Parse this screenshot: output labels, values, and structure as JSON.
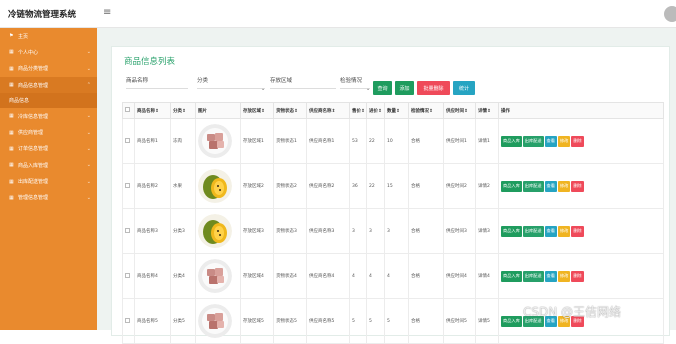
{
  "app": {
    "title": "冷链物流管理系统",
    "menu_icon": "menu-icon"
  },
  "sidebar": {
    "items": [
      {
        "label": "主页",
        "icon": "flag-icon",
        "chevron": false
      },
      {
        "label": "个人中心",
        "icon": "grid-icon",
        "chevron": true
      },
      {
        "label": "商品分类管理",
        "icon": "grid-icon",
        "chevron": true
      },
      {
        "label": "商品信息管理",
        "icon": "grid-icon",
        "chevron": true,
        "open": true
      },
      {
        "label": "冷库信息管理",
        "icon": "grid-icon",
        "chevron": true
      },
      {
        "label": "供应商管理",
        "icon": "grid-icon",
        "chevron": true
      },
      {
        "label": "订单信息管理",
        "icon": "grid-icon",
        "chevron": true
      },
      {
        "label": "商品入库管理",
        "icon": "grid-icon",
        "chevron": true
      },
      {
        "label": "出库配送管理",
        "icon": "grid-icon",
        "chevron": true
      },
      {
        "label": "管理信息管理",
        "icon": "grid-icon",
        "chevron": true
      }
    ],
    "sub_item": "商品信息"
  },
  "card": {
    "title": "商品信息列表"
  },
  "filters": {
    "name_label": "商品名称",
    "category_label": "分类",
    "storage_label": "存放区域",
    "inspection_label": "检验情况"
  },
  "buttons": {
    "query": "查询",
    "add": "添加",
    "batch_delete": "批量删除",
    "stats": "统计"
  },
  "table": {
    "headers": [
      "商品名称⇕",
      "分类⇕",
      "图片",
      "存放区域⇕",
      "货物状态⇕",
      "供应商名称⇕",
      "售价⇕",
      "进价⇕",
      "数量⇕",
      "检验情况⇕",
      "供应时间⇕",
      "详情⇕",
      "操作"
    ],
    "rows": [
      {
        "name": "商品名称1",
        "category": "冻肉",
        "image": "meat",
        "area": "存放区域1",
        "status": "货物状态1",
        "supplier": "供应商名称1",
        "price": "53",
        "cost": "22",
        "qty": "10",
        "check": "合格",
        "time": "供应时间1",
        "detail": "详情1"
      },
      {
        "name": "商品名称2",
        "category": "水果",
        "image": "fruit",
        "area": "存放区域2",
        "status": "货物状态2",
        "supplier": "供应商名称2",
        "price": "36",
        "cost": "22",
        "qty": "15",
        "check": "合格",
        "time": "供应时间2",
        "detail": "详情2"
      },
      {
        "name": "商品名称3",
        "category": "分类3",
        "image": "fruit",
        "area": "存放区域3",
        "status": "货物状态3",
        "supplier": "供应商名称3",
        "price": "3",
        "cost": "3",
        "qty": "3",
        "check": "合格",
        "time": "供应时间3",
        "detail": "详情3"
      },
      {
        "name": "商品名称4",
        "category": "分类4",
        "image": "meat",
        "area": "存放区域4",
        "status": "货物状态4",
        "supplier": "供应商名称4",
        "price": "4",
        "cost": "4",
        "qty": "4",
        "check": "合格",
        "time": "供应时间4",
        "detail": "详情4"
      },
      {
        "name": "商品名称5",
        "category": "分类5",
        "image": "meat",
        "area": "存放区域5",
        "status": "货物状态5",
        "supplier": "供应商名称5",
        "price": "5",
        "cost": "5",
        "qty": "5",
        "check": "合格",
        "time": "供应时间5",
        "detail": "详情5"
      }
    ],
    "row_ops": [
      "商品入库",
      "出库配送",
      "查看",
      "修改",
      "删除"
    ]
  },
  "watermark": "CSDN @王佶网络",
  "colors": {
    "sidebar": "#e98a2e",
    "accent": "#2aa26c",
    "query": "#1f9c5e",
    "batch_delete": "#ef4a5a",
    "stats": "#26a4c2",
    "edit": "#f0b422"
  }
}
